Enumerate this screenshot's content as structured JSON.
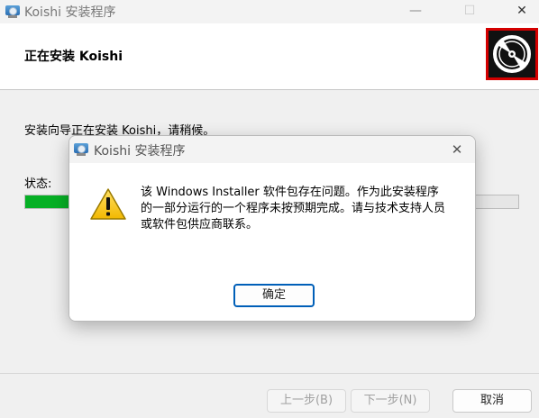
{
  "main_window": {
    "title": "Koishi 安装程序",
    "minimize_glyph": "—",
    "maximize_glyph": "☐",
    "close_glyph": "✕"
  },
  "header": {
    "title": "正在安装 Koishi",
    "logo_icon": "disc-logo-icon"
  },
  "content": {
    "progress_text": "安装向导正在安装 Koishi，请稍候。",
    "status_label": "状态:",
    "progress_fraction": 0.12
  },
  "footer": {
    "back_label": "上一步(B)",
    "next_label": "下一步(N)",
    "cancel_label": "取消"
  },
  "dialog": {
    "title": "Koishi 安装程序",
    "close_glyph": "✕",
    "icon": "warning-icon",
    "message": "该 Windows Installer 软件包存在问题。作为此安装程序的一部分运行的一个程序未按预期完成。请与技术支持人员或软件包供应商联系。",
    "ok_label": "确定"
  },
  "colors": {
    "progress_fill": "#06b025",
    "logo_border": "#d40000",
    "accent": "#005fb8"
  }
}
